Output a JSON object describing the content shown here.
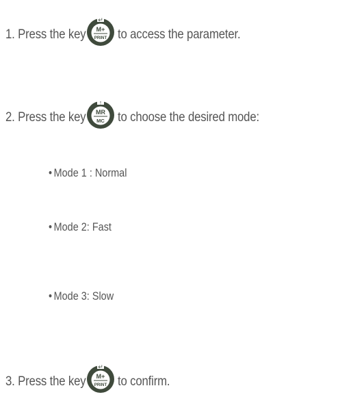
{
  "steps": [
    {
      "before": "1. Press the key",
      "key": {
        "icon": "m-plus-print-key-icon",
        "top": "M+",
        "bottom": "PRINT",
        "arrow": "↵"
      },
      "after": "to access the parameter."
    },
    {
      "before": "2. Press the key",
      "key": {
        "icon": "mr-mc-key-icon",
        "top": "MR",
        "bottom": "MC",
        "arrow": "↑"
      },
      "after": "to choose the desired mode:"
    },
    {
      "before": "3. Press the key",
      "key": {
        "icon": "m-plus-print-key-icon",
        "top": "M+",
        "bottom": "PRINT",
        "arrow": "↵"
      },
      "after": "to confirm."
    }
  ],
  "modes": [
    "Mode 1 : Normal",
    "Mode 2: Fast",
    "Mode 3: Slow"
  ],
  "bullet_char": "•",
  "colors": {
    "text": "#555555",
    "key_ring": "#3f4a3c",
    "key_face": "#ffffff"
  }
}
